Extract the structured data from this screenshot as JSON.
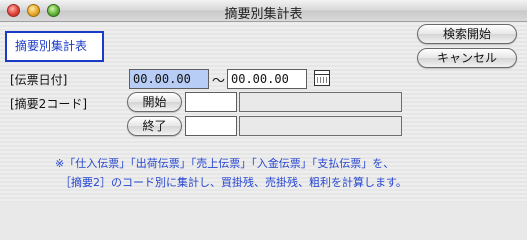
{
  "window": {
    "title": "摘要別集計表"
  },
  "heading": "摘要別集計表",
  "buttons": {
    "search_start": "検索開始",
    "cancel": "キャンセル",
    "start": "開始",
    "end": "終了"
  },
  "form": {
    "date_label": "[伝票日付]",
    "date_from": "00.00.00",
    "date_separator": "～",
    "date_to": "00.00.00",
    "code_label": "[摘要2コード]"
  },
  "note": {
    "line1": "※「仕入伝票」「出荷伝票」「売上伝票」「入金伝票」「支払伝票」を、",
    "line2": "［摘要2］のコード別に集計し、買掛残、売掛残、粗利を計算します。"
  },
  "icons": {
    "calendar": "calendar-icon"
  },
  "colors": {
    "accent": "#1a3bc7",
    "note_text": "#2646d0",
    "selected_field": "#b7cdf6"
  }
}
